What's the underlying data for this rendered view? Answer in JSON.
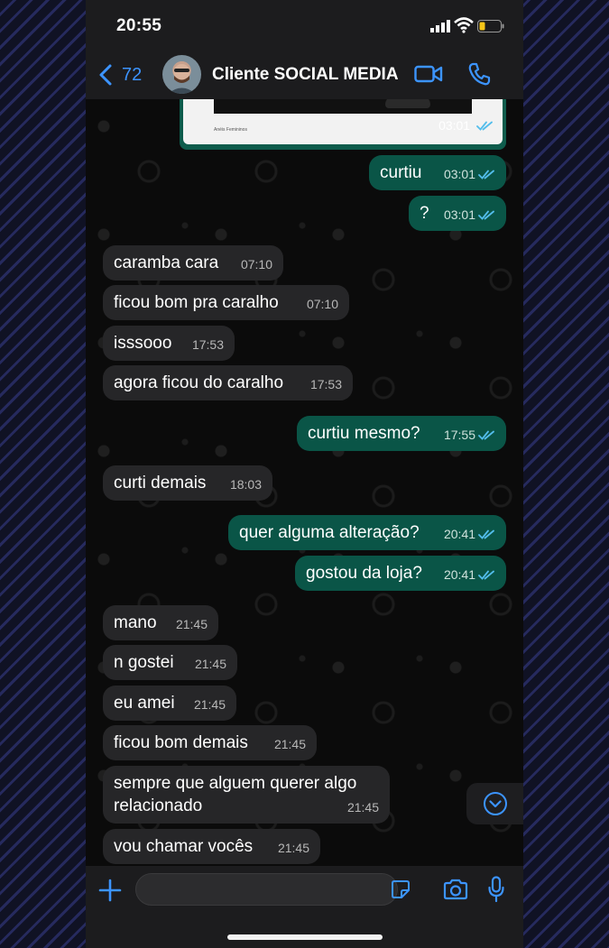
{
  "status": {
    "time": "20:55"
  },
  "header": {
    "back_count": "72",
    "title": "Cliente SOCIAL MEDIA"
  },
  "image_message": {
    "caption": "Anéis Femininos",
    "time": "03:01"
  },
  "messages": [
    {
      "dir": "out",
      "text": "curtiu",
      "time": "03:01"
    },
    {
      "dir": "out",
      "text": "?",
      "time": "03:01"
    },
    {
      "dir": "in",
      "text": "caramba cara",
      "time": "07:10"
    },
    {
      "dir": "in",
      "text": "ficou bom pra caralho",
      "time": "07:10"
    },
    {
      "dir": "in",
      "text": "isssooo",
      "time": "17:53"
    },
    {
      "dir": "in",
      "text": "agora ficou do caralho",
      "time": "17:53"
    },
    {
      "dir": "out",
      "text": "curtiu mesmo?",
      "time": "17:55"
    },
    {
      "dir": "in",
      "text": "curti demais",
      "time": "18:03"
    },
    {
      "dir": "out",
      "text": "quer alguma alteração?",
      "time": "20:41"
    },
    {
      "dir": "out",
      "text": "gostou da loja?",
      "time": "20:41"
    },
    {
      "dir": "in",
      "text": "mano",
      "time": "21:45"
    },
    {
      "dir": "in",
      "text": "n gostei",
      "time": "21:45"
    },
    {
      "dir": "in",
      "text": "eu amei",
      "time": "21:45"
    },
    {
      "dir": "in",
      "text": "ficou bom demais",
      "time": "21:45"
    },
    {
      "dir": "in",
      "text": "sempre que alguem querer algo relacionado",
      "time": "21:45"
    },
    {
      "dir": "in",
      "text": "vou chamar vocês",
      "time": "21:45"
    }
  ],
  "input": {
    "value": "",
    "placeholder": ""
  },
  "colors": {
    "accent": "#3c94ff",
    "outgoing_bubble": "#0a5547",
    "incoming_bubble": "#262628",
    "read_tick": "#53bdeb"
  },
  "icons": [
    "back-chevron-icon",
    "video-call-icon",
    "phone-call-icon",
    "plus-icon",
    "sticker-icon",
    "camera-icon",
    "microphone-icon",
    "scroll-down-icon",
    "read-receipt-icon"
  ]
}
